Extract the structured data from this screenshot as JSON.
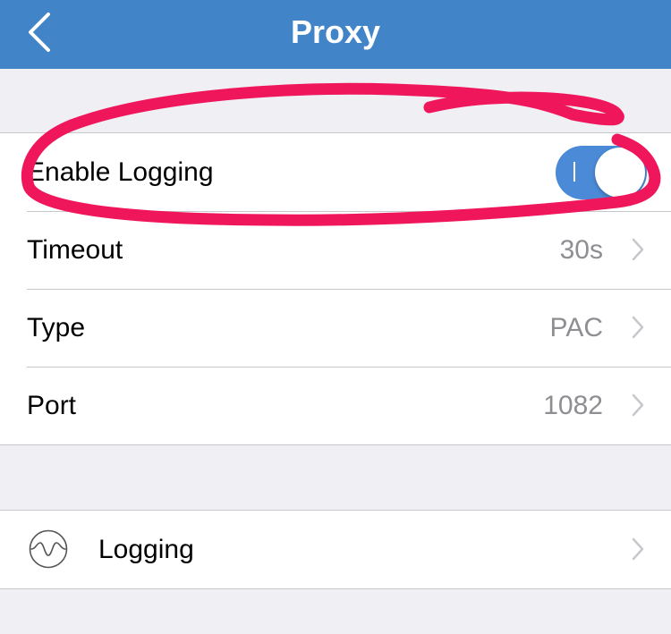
{
  "navbar": {
    "title": "Proxy",
    "back_icon": "chevron-left-icon"
  },
  "settings": {
    "enable_logging": {
      "label": "Enable Logging",
      "enabled": true,
      "toggle_glyph": "I"
    },
    "rows": [
      {
        "label": "Timeout",
        "value": "30s"
      },
      {
        "label": "Type",
        "value": "PAC"
      },
      {
        "label": "Port",
        "value": "1082"
      }
    ]
  },
  "links": {
    "logging": {
      "label": "Logging",
      "icon": "waveform-icon"
    }
  },
  "colors": {
    "navbar": "#4185c8",
    "toggle_on": "#4a8ad6",
    "annotation": "#f0165c",
    "background": "#efeff4"
  }
}
